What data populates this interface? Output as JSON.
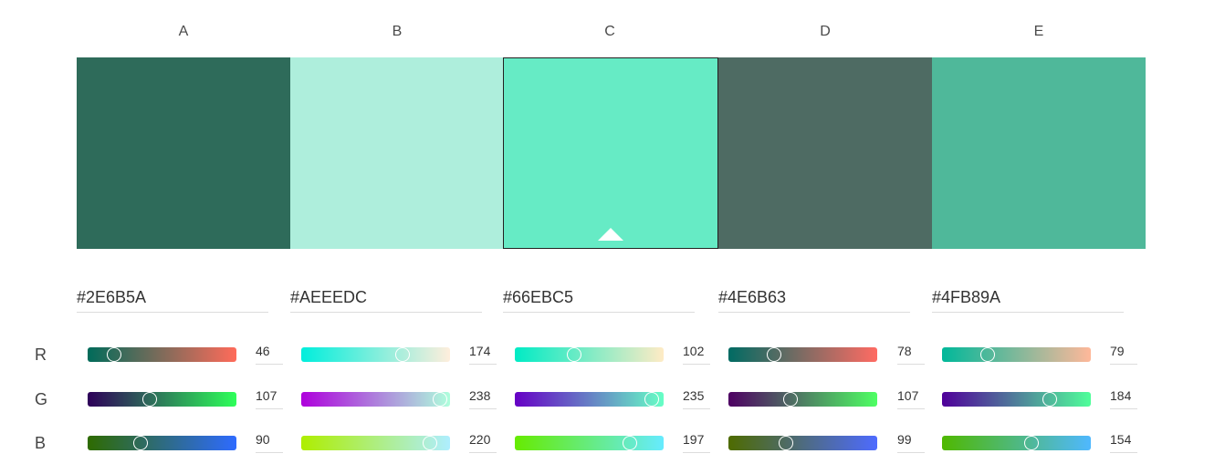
{
  "columns": [
    {
      "letter": "A",
      "color": "#2E6B5A",
      "hex": "#2E6B5A",
      "r": 46,
      "g": 107,
      "b": 90,
      "selected": false
    },
    {
      "letter": "B",
      "color": "#AEEEDC",
      "hex": "#AEEEDC",
      "r": 174,
      "g": 238,
      "b": 220,
      "selected": false
    },
    {
      "letter": "C",
      "color": "#66EBC5",
      "hex": "#66EBC5",
      "r": 102,
      "g": 235,
      "b": 197,
      "selected": true
    },
    {
      "letter": "D",
      "color": "#4E6B63",
      "hex": "#4E6B63",
      "r": 78,
      "g": 107,
      "b": 99,
      "selected": false
    },
    {
      "letter": "E",
      "color": "#4FB89A",
      "hex": "#4FB89A",
      "r": 79,
      "g": 184,
      "b": 154,
      "selected": false
    }
  ],
  "channels": [
    "R",
    "G",
    "B"
  ],
  "icons": {
    "selected_marker": "triangle-up-icon"
  }
}
